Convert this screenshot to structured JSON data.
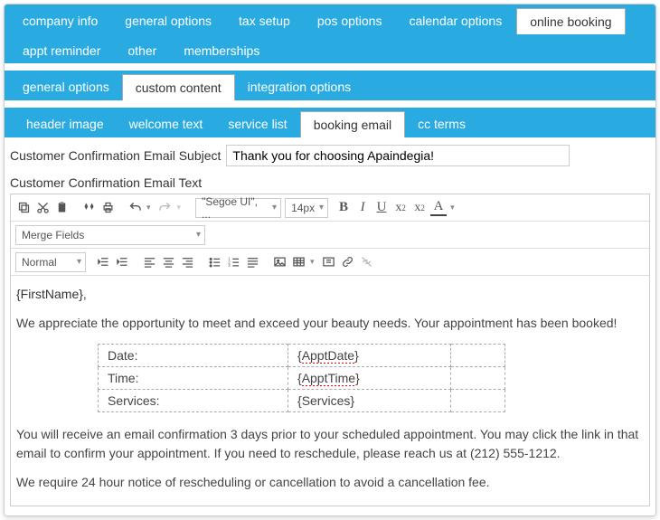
{
  "topTabs": {
    "row1": [
      "company info",
      "general options",
      "tax setup",
      "pos options",
      "calendar options",
      "online booking"
    ],
    "row2": [
      "appt reminder",
      "other",
      "memberships"
    ],
    "active": "online booking"
  },
  "midTabs": {
    "items": [
      "general options",
      "custom content",
      "integration options"
    ],
    "active": "custom content"
  },
  "subTabs": {
    "items": [
      "header image",
      "welcome text",
      "service list",
      "booking email",
      "cc terms"
    ],
    "active": "booking email"
  },
  "subject": {
    "label": "Customer Confirmation Email Subject",
    "value": "Thank you for choosing Apaindegia!"
  },
  "bodyLabel": "Customer Confirmation Email Text",
  "toolbar": {
    "font": "\"Segoe UI\", ...",
    "size": "14px",
    "mergeFields": "Merge Fields",
    "paraStyle": "Normal"
  },
  "email": {
    "greetingToken": "{FirstName}",
    "greetingSuffix": ",",
    "p1": "We appreciate the opportunity to meet and exceed your beauty needs. Your appointment has been booked!",
    "table": [
      {
        "label": "Date:",
        "token": "{",
        "word": "ApptDate",
        "close": "}"
      },
      {
        "label": "Time:",
        "token": "{",
        "word": "ApptTime",
        "close": "}"
      },
      {
        "label": "Services:",
        "token": "{",
        "word": "Services",
        "close": "}",
        "nowave": true
      }
    ],
    "p2": "You will receive an email confirmation 3 days prior to your scheduled appointment. You may click the link in that email to confirm your appointment. If you need to reschedule, please reach us at (212) 555-1212.",
    "p3": "We require 24 hour notice of rescheduling or cancellation to avoid a cancellation fee."
  }
}
